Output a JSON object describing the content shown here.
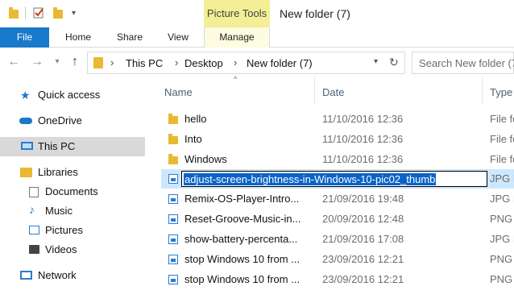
{
  "titlebar": {
    "context_tab": "Picture Tools",
    "title": "New folder (7)"
  },
  "ribbon": {
    "tabs": [
      "File",
      "Home",
      "Share",
      "View",
      "Manage"
    ]
  },
  "address": {
    "crumbs": [
      "This PC",
      "Desktop",
      "New folder (7)"
    ],
    "search_placeholder": "Search New folder (7)"
  },
  "nav": {
    "quick_access": "Quick access",
    "onedrive": "OneDrive",
    "thispc": "This PC",
    "libraries": "Libraries",
    "lib_items": [
      "Documents",
      "Music",
      "Pictures",
      "Videos"
    ],
    "network": "Network"
  },
  "columns": {
    "name": "Name",
    "date": "Date",
    "type": "Type"
  },
  "files": [
    {
      "name": "hello",
      "date": "11/10/2016 12:36",
      "type": "File fo",
      "kind": "folder"
    },
    {
      "name": "Into",
      "date": "11/10/2016 12:36",
      "type": "File fo",
      "kind": "folder"
    },
    {
      "name": "Windows",
      "date": "11/10/2016 12:36",
      "type": "File fo",
      "kind": "folder"
    },
    {
      "name": "adjust-screen-brightness-in-Windows-10-pic02_thumb",
      "date": "",
      "type": "JPG F",
      "kind": "image",
      "renaming": true
    },
    {
      "name": "Remix-OS-Player-Intro...",
      "date": "21/09/2016 19:48",
      "type": "JPG F",
      "kind": "image"
    },
    {
      "name": "Reset-Groove-Music-in...",
      "date": "20/09/2016 12:48",
      "type": "PNG",
      "kind": "image"
    },
    {
      "name": "show-battery-percenta...",
      "date": "21/09/2016 17:08",
      "type": "JPG F",
      "kind": "image"
    },
    {
      "name": "stop Windows 10 from ...",
      "date": "23/09/2016 12:21",
      "type": "PNG",
      "kind": "image"
    },
    {
      "name": "stop Windows 10 from ...",
      "date": "23/09/2016 12:21",
      "type": "PNG",
      "kind": "image"
    }
  ]
}
